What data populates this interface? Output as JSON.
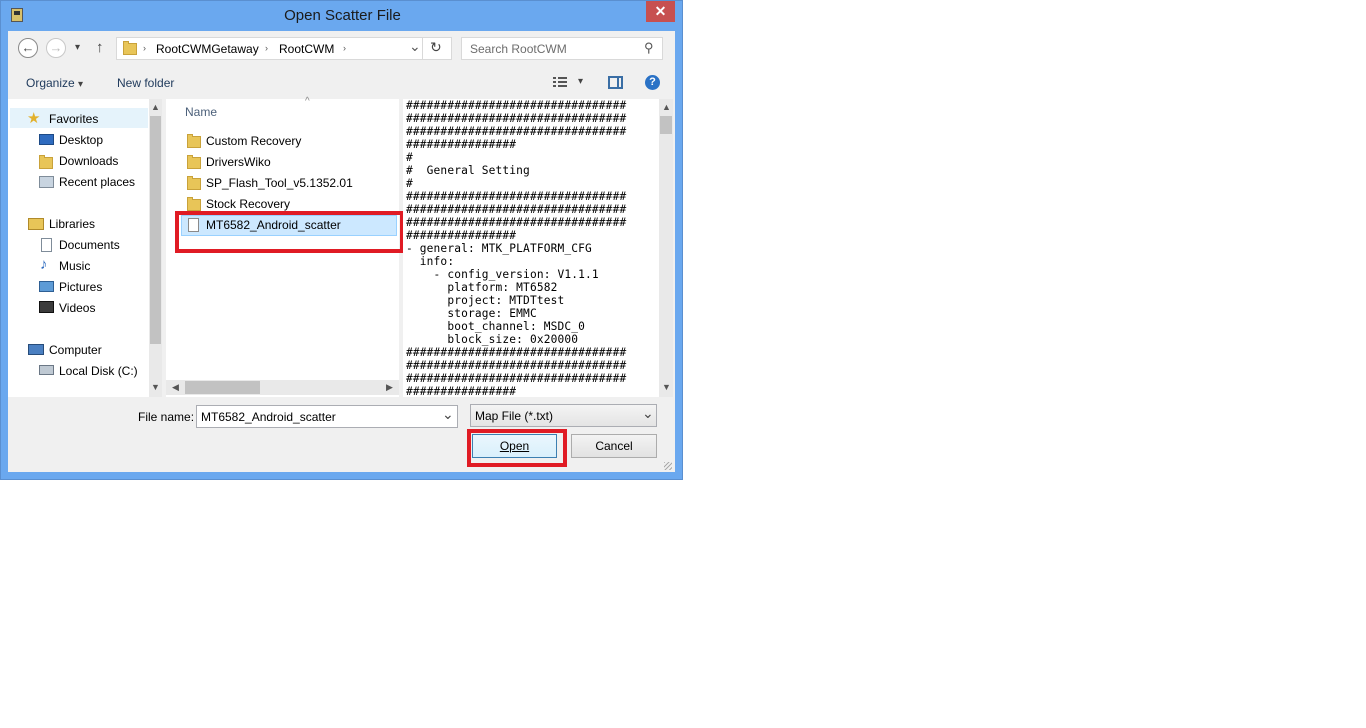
{
  "window": {
    "title": "Open Scatter File",
    "close_glyph": "✕"
  },
  "navigation": {
    "back_glyph": "←",
    "forward_glyph": "→",
    "recent_glyph": "▾",
    "up_glyph": "↑",
    "breadcrumb": [
      "RootCWMGetaway",
      "RootCWM"
    ],
    "breadcrumb_separator": "›",
    "refresh_glyph": "↻",
    "dropdown_glyph": "⌄",
    "search_placeholder": "Search RootCWM",
    "search_icon_glyph": "⚲"
  },
  "toolbar": {
    "organize_label": "Organize",
    "organize_arrow": "▾",
    "new_folder_label": "New folder",
    "view_arrow": "▾",
    "help_glyph": "?"
  },
  "nav_pane": {
    "favorites_label": "Favorites",
    "favorites_items": [
      "Desktop",
      "Downloads",
      "Recent places"
    ],
    "libraries_label": "Libraries",
    "libraries_items": [
      "Documents",
      "Music",
      "Pictures",
      "Videos"
    ],
    "computer_label": "Computer",
    "computer_items": [
      "Local Disk (C:)"
    ]
  },
  "file_list": {
    "column_header": "Name",
    "sort_glyph": "^",
    "items": [
      {
        "name": "Custom Recovery",
        "type": "folder"
      },
      {
        "name": "DriversWiko",
        "type": "folder"
      },
      {
        "name": "SP_Flash_Tool_v5.1352.01",
        "type": "folder"
      },
      {
        "name": "Stock Recovery",
        "type": "folder"
      },
      {
        "name": "MT6582_Android_scatter",
        "type": "file",
        "selected": true
      }
    ]
  },
  "preview": {
    "text": "################################\n################################\n################################\n################\n#\n#  General Setting\n#\n################################\n################################\n################################\n################\n- general: MTK_PLATFORM_CFG\n  info:\n    - config_version: V1.1.1\n      platform: MT6582\n      project: MTDTtest\n      storage: EMMC\n      boot_channel: MSDC_0\n      block_size: 0x20000\n################################\n################################\n################################\n################"
  },
  "footer": {
    "file_name_label": "File name:",
    "file_name_value": "MT6582_Android_scatter",
    "file_type_value": "Map File (*.txt)",
    "open_label": "Open",
    "cancel_label": "Cancel"
  },
  "scroll_glyphs": {
    "up": "▲",
    "down": "▼",
    "left": "◀",
    "right": "▶"
  },
  "colors": {
    "title_bar": "#6aa8ef",
    "close_button": "#c75050",
    "highlight_box": "#e01b24",
    "selection": "#cce8ff"
  }
}
